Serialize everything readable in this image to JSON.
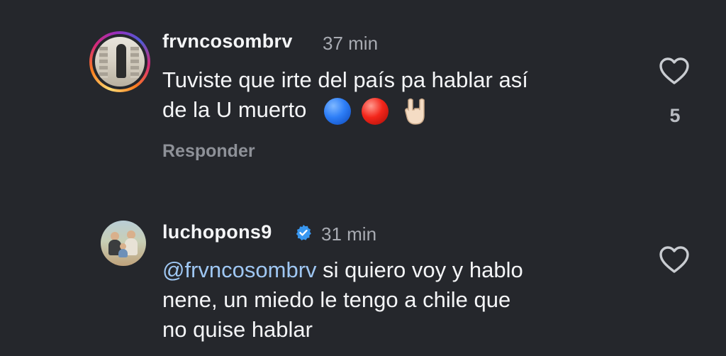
{
  "comments": [
    {
      "username": "frvncosombrv",
      "time": "37 min",
      "text_line1": "Tuviste que irte del país pa hablar así",
      "text_line2": "de la U muerto",
      "emojis": [
        "blue-circle",
        "red-circle",
        "sign-of-the-horns"
      ],
      "reply_label": "Responder",
      "likes": "5",
      "has_story_ring": true
    },
    {
      "username": "luchopons9",
      "verified": true,
      "time": "31 min",
      "mention": "@frvncosombrv",
      "text_line1": " si quiero voy y hablo",
      "text_line2": "nene, un miedo le tengo a chile que",
      "text_line3": "no quise hablar"
    }
  ],
  "icons": {
    "like": "heart-outline-icon",
    "verified": "verified-badge-icon"
  },
  "colors": {
    "background": "#25272c",
    "mention": "#9fc7f3",
    "verified": "#3897f0",
    "muted": "#a8abb2"
  }
}
